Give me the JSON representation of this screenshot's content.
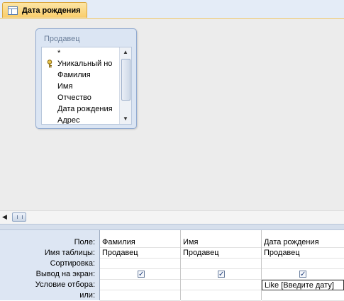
{
  "tab": {
    "label": "Дата рождения",
    "icon": "query-table-icon"
  },
  "table_box": {
    "title": "Продавец",
    "fields": [
      {
        "label": "*",
        "key": false
      },
      {
        "label": "Уникальный но",
        "key": true
      },
      {
        "label": "Фамилия",
        "key": false
      },
      {
        "label": "Имя",
        "key": false
      },
      {
        "label": "Отчество",
        "key": false
      },
      {
        "label": "Дата рождения",
        "key": false
      },
      {
        "label": "Адрес",
        "key": false
      }
    ]
  },
  "grid": {
    "row_labels": {
      "field": "Поле:",
      "table": "Имя таблицы:",
      "sort": "Сортировка:",
      "show": "Вывод на экран:",
      "criteria": "Условие отбора:",
      "or": "или:"
    },
    "columns": [
      {
        "field": "Фамилия",
        "table": "Продавец",
        "sort": "",
        "show": true,
        "criteria": "",
        "or": ""
      },
      {
        "field": "Имя",
        "table": "Продавец",
        "sort": "",
        "show": true,
        "criteria": "",
        "or": ""
      },
      {
        "field": "Дата рождения",
        "table": "Продавец",
        "sort": "",
        "show": true,
        "criteria": "Like [Введите дату]",
        "or": ""
      }
    ]
  },
  "colors": {
    "tab_active": "#f9cd6a",
    "design_bg": "#ececec",
    "grid_header_bg": "#dde6f3"
  }
}
